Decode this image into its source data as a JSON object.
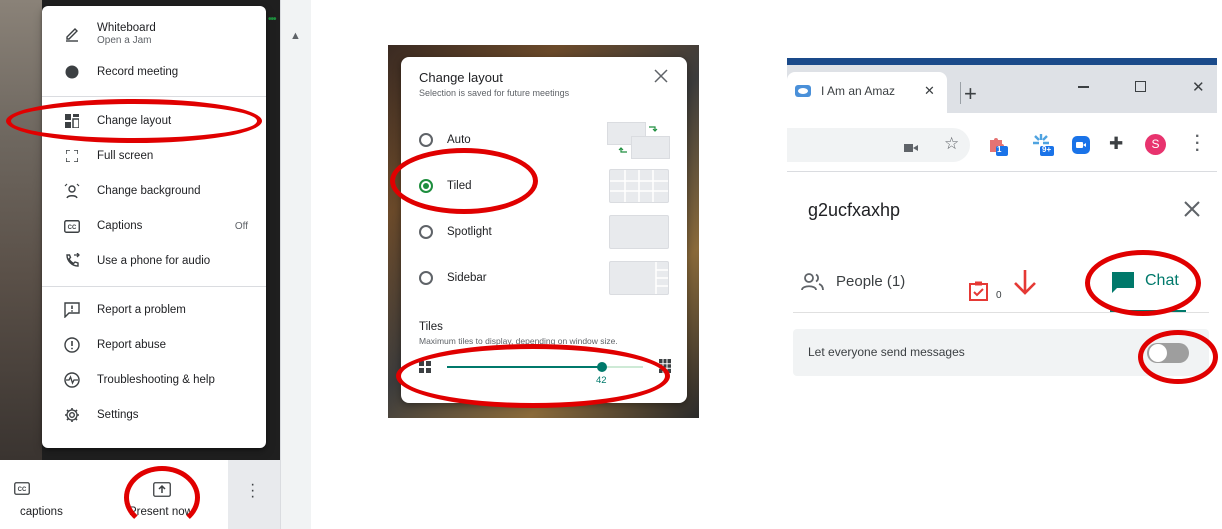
{
  "colors": {
    "accent_green": "#1e8e3e",
    "annotation_red": "#e00000",
    "teal": "#00796b"
  },
  "panel1": {
    "menu_items": [
      {
        "label": "Whiteboard",
        "sub": "Open a Jam",
        "icon": "pencil-icon"
      },
      {
        "label": "Record meeting",
        "icon": "record-icon"
      },
      {
        "label": "Change layout",
        "icon": "layout-icon"
      },
      {
        "label": "Full screen",
        "icon": "fullscreen-icon"
      },
      {
        "label": "Change background",
        "icon": "background-icon"
      },
      {
        "label": "Captions",
        "end": "Off",
        "icon": "captions-icon"
      },
      {
        "label": "Use a phone for audio",
        "icon": "phone-icon"
      },
      {
        "label": "Report a problem",
        "icon": "report-problem-icon"
      },
      {
        "label": "Report abuse",
        "icon": "report-abuse-icon"
      },
      {
        "label": "Troubleshooting & help",
        "icon": "troubleshooting-icon"
      },
      {
        "label": "Settings",
        "icon": "gear-icon"
      }
    ],
    "bottom": {
      "captions_label": "captions",
      "present_label": "Present now"
    }
  },
  "panel2": {
    "title": "Change layout",
    "subtitle": "Selection is saved for future meetings",
    "options": [
      {
        "label": "Auto"
      },
      {
        "label": "Tiled",
        "selected": true
      },
      {
        "label": "Spotlight"
      },
      {
        "label": "Sidebar"
      }
    ],
    "tiles_title": "Tiles",
    "tiles_desc": "Maximum tiles to display, depending on window size.",
    "tiles_value": "42",
    "tiles_fraction": 0.79
  },
  "panel3": {
    "tab_title": "I Am an Amaz",
    "badges": {
      "ext1": "1",
      "ext2": "9+"
    },
    "avatar_letter": "S",
    "meeting_code": "g2ucfxaxhp",
    "people_label": "People (1)",
    "task_count": "0",
    "chat_label": "Chat",
    "toggle_label": "Let everyone send messages",
    "toggle_on": false
  }
}
